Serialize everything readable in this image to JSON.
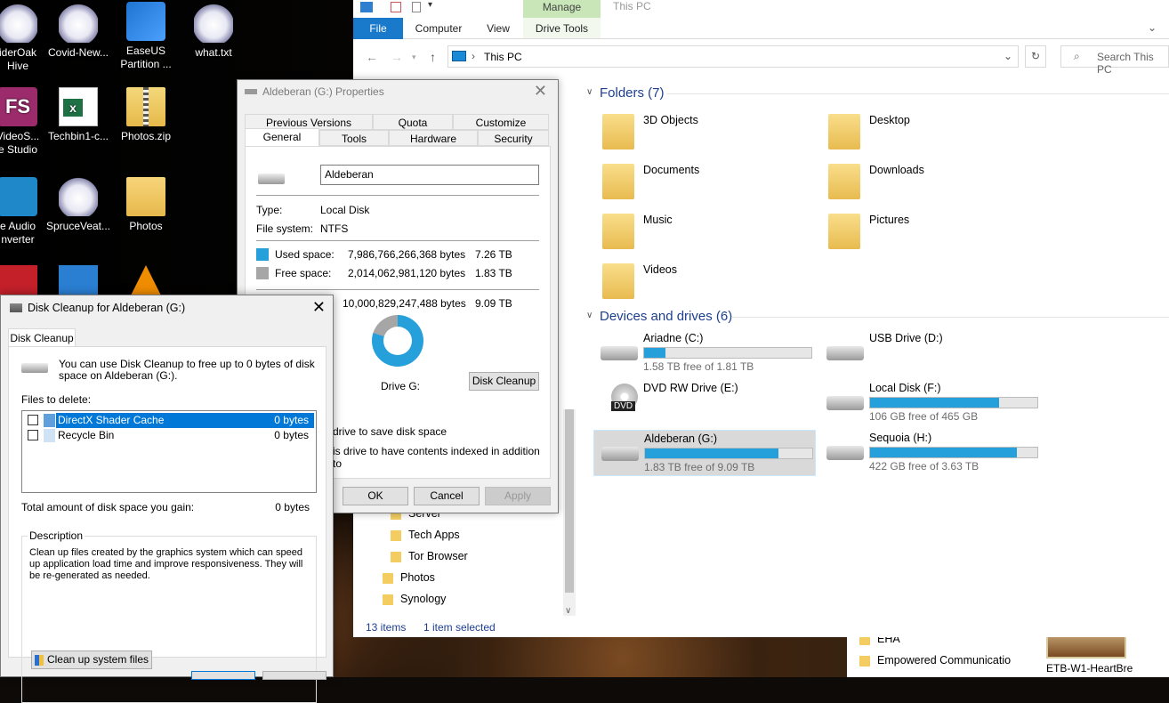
{
  "desktop": {
    "icons": [
      {
        "label": "iderOak\nHive",
        "type": "cloud"
      },
      {
        "label": "Covid-New...",
        "type": "cloud"
      },
      {
        "label": "EaseUS\nPartition ...",
        "type": "easeus"
      },
      {
        "label": "what.txt",
        "type": "cloud"
      },
      {
        "label": "VideoS...\ne Studio",
        "type": "fs"
      },
      {
        "label": "Techbin1-c...",
        "type": "excel"
      },
      {
        "label": "Photos.zip",
        "type": "zip"
      },
      {
        "label": "e Audio\nnverter",
        "type": "headphones"
      },
      {
        "label": "SpruceVeat...",
        "type": "cloud"
      },
      {
        "label": "Photos",
        "type": "folder"
      }
    ],
    "bottom_items": [
      "EHA",
      "Empowered Communicatio",
      "ETB-W1-HeartBre"
    ]
  },
  "explorer": {
    "window_title": "This PC",
    "manage_tab": "Manage",
    "tabs": [
      "File",
      "Computer",
      "View",
      "Drive Tools"
    ],
    "address": "This PC",
    "search_placeholder": "Search This PC",
    "folders_header": "Folders (7)",
    "folders": [
      "3D Objects",
      "Desktop",
      "Documents",
      "Downloads",
      "Music",
      "Pictures",
      "Videos"
    ],
    "devices_header": "Devices and drives (6)",
    "drives": [
      {
        "name": "Ariadne (C:)",
        "free": "1.58 TB free of 1.81 TB",
        "used_fraction": 0.13
      },
      {
        "name": "USB Drive (D:)",
        "free": "",
        "used_fraction": null
      },
      {
        "name": "DVD RW Drive (E:)",
        "free": "",
        "used_fraction": null
      },
      {
        "name": "Local Disk (F:)",
        "free": "106 GB free of 465 GB",
        "used_fraction": 0.77
      },
      {
        "name": "Aldeberan (G:)",
        "free": "1.83 TB free of 9.09 TB",
        "used_fraction": 0.8
      },
      {
        "name": "Sequoia (H:)",
        "free": "422 GB free of 3.63 TB",
        "used_fraction": 0.88
      }
    ],
    "dvd_label": "DVD",
    "nav_folders": [
      "Server",
      "Tech Apps",
      "Tor Browser",
      "Photos",
      "Synology"
    ],
    "status_items": "13 items",
    "status_selected": "1 item selected"
  },
  "properties": {
    "title": "Aldeberan (G:) Properties",
    "tabs_row1": [
      "Previous Versions",
      "Quota",
      "Customize"
    ],
    "tabs_row2": [
      "General",
      "Tools",
      "Hardware",
      "Security"
    ],
    "name_value": "Aldeberan",
    "type_label": "Type:",
    "type_value": "Local Disk",
    "fs_label": "File system:",
    "fs_value": "NTFS",
    "used_label": "Used space:",
    "used_bytes": "7,986,766,266,368 bytes",
    "used_size": "7.26 TB",
    "free_label": "Free space:",
    "free_bytes": "2,014,062,981,120 bytes",
    "free_size": "1.83 TB",
    "cap_bytes": "10,000,829,247,488 bytes",
    "cap_size": "9.09 TB",
    "drive_label": "Drive G:",
    "cleanup_button": "Disk Cleanup",
    "compress_text": "drive to save disk space",
    "index_text": "is drive to have contents indexed in addition to",
    "ok": "OK",
    "cancel": "Cancel",
    "apply": "Apply",
    "used_color": "#26a0da",
    "free_color": "#a6a6a6",
    "used_fraction": 0.8
  },
  "cleanup": {
    "title": "Disk Cleanup for Aldeberan (G:)",
    "tab": "Disk Cleanup",
    "intro": "You can use Disk Cleanup to free up to 0 bytes of disk space on Aldeberan (G:).",
    "files_label": "Files to delete:",
    "files": [
      {
        "name": "DirectX Shader Cache",
        "size": "0 bytes"
      },
      {
        "name": "Recycle Bin",
        "size": "0 bytes"
      }
    ],
    "total_label": "Total amount of disk space you gain:",
    "total_value": "0 bytes",
    "description_label": "Description",
    "description": "Clean up files created by the graphics system which can speed up application load time and improve responsiveness. They will be re-generated as needed.",
    "system_files_button": "Clean up system files"
  }
}
